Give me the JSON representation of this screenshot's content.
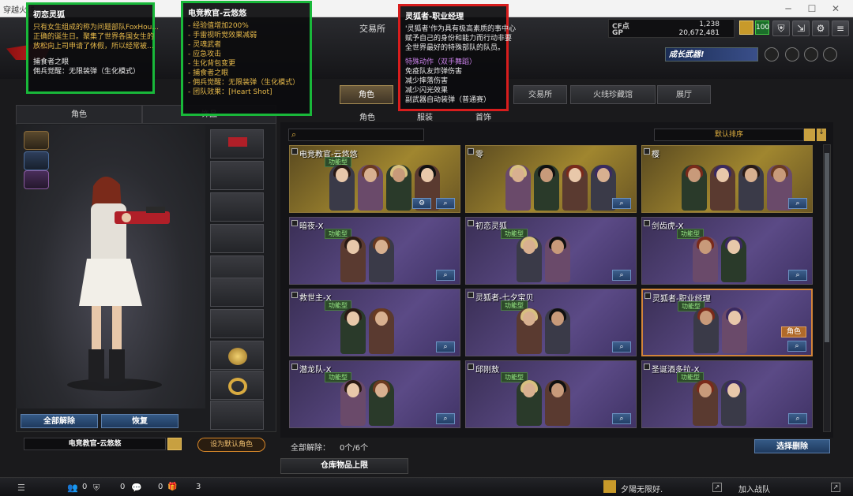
{
  "window": {
    "title": "穿越火线"
  },
  "topnav": {
    "exchange": "交易所"
  },
  "currency": {
    "cf_label": "CF点",
    "cf_value": "1,238",
    "gp_label": "GP",
    "gp_value": "20,672,481"
  },
  "level_badge": "100",
  "banner": "成长武器!",
  "main_tabs": [
    {
      "label": "角色"
    },
    {
      "label": "交易所"
    },
    {
      "label": "火线珍藏馆"
    },
    {
      "label": "展厅"
    }
  ],
  "sub_tabs": [
    {
      "label": "角色"
    },
    {
      "label": "服装"
    },
    {
      "label": "首饰"
    }
  ],
  "left_tabs": [
    {
      "label": "角色"
    },
    {
      "label": "饰品"
    }
  ],
  "left_buttons": {
    "clear_all": "全部解除",
    "restore": "恢复"
  },
  "selected_character": "电竞教官-云悠悠",
  "set_default": "设为默认角色",
  "sort_label": "默认排序",
  "cards": [
    {
      "name": "电竞教官-云悠悠",
      "type": "功能型",
      "gold": true
    },
    {
      "name": "零",
      "type": "",
      "gold": true
    },
    {
      "name": "樱",
      "type": "",
      "gold": true
    },
    {
      "name": "暗夜-X",
      "type": "功能型",
      "gold": false
    },
    {
      "name": "初恋灵狐",
      "type": "功能型",
      "gold": false
    },
    {
      "name": "剑齿虎-X",
      "type": "功能型",
      "gold": false
    },
    {
      "name": "救世主-X",
      "type": "功能型",
      "gold": false
    },
    {
      "name": "灵狐者-七夕宝贝",
      "type": "功能型",
      "gold": false
    },
    {
      "name": "灵狐者-职业经理",
      "type": "功能型",
      "gold": false,
      "owned": "角色"
    },
    {
      "name": "潜龙队-X",
      "type": "功能型",
      "gold": false
    },
    {
      "name": "邱刚敖",
      "type": "功能型",
      "gold": false
    },
    {
      "name": "圣诞酒多拉-X",
      "type": "功能型",
      "gold": false
    }
  ],
  "bottom_right": {
    "clear_all": "全部解除：",
    "count": "0个/6个",
    "select_clear": "选择删除"
  },
  "storage_limit": "仓库物品上限",
  "footer": {
    "num1": "0",
    "num2": "0",
    "num3": "0",
    "num4": "3",
    "player": "夕陽无限好.",
    "join": "加入战队"
  },
  "tooltip_1": {
    "title": "初恋灵狐",
    "desc": [
      "只有女生组成的称为问题部队FoxHou...",
      "正确的诞生日。聚集了世界各国女生的",
      "放松向上司申请了休假，所以经常被..."
    ],
    "skill_title": "捕食者之眼",
    "skill": "佣兵觉醒：无限装弹（生化模式）"
  },
  "tooltip_2": {
    "title": "电竞教官-云悠悠",
    "lines": [
      "- 经验值增加200%",
      "- 手雷视听觉效果减弱",
      "- 灵魂武者",
      "- 应急攻击",
      "- 生化背包变更",
      "- 捕食者之眼",
      "- 佣兵觉醒：无限装弹（生化模式）",
      "- 团队效果：[Heart Shot]"
    ]
  },
  "tooltip_3": {
    "title": "灵狐者-职业经理",
    "desc": [
      "'灵狐者'作为具有极高素质的事中心",
      "赋予自己的身份和能力而行动非要",
      "全世界最好的特殊部队的队员。"
    ],
    "action": "特殊动作（双手舞蹈）",
    "effects": [
      "免疫队友炸弹伤害",
      "减少摔落伤害",
      "减少闪光效果",
      "副武器自动装弹（普通赛）"
    ]
  }
}
